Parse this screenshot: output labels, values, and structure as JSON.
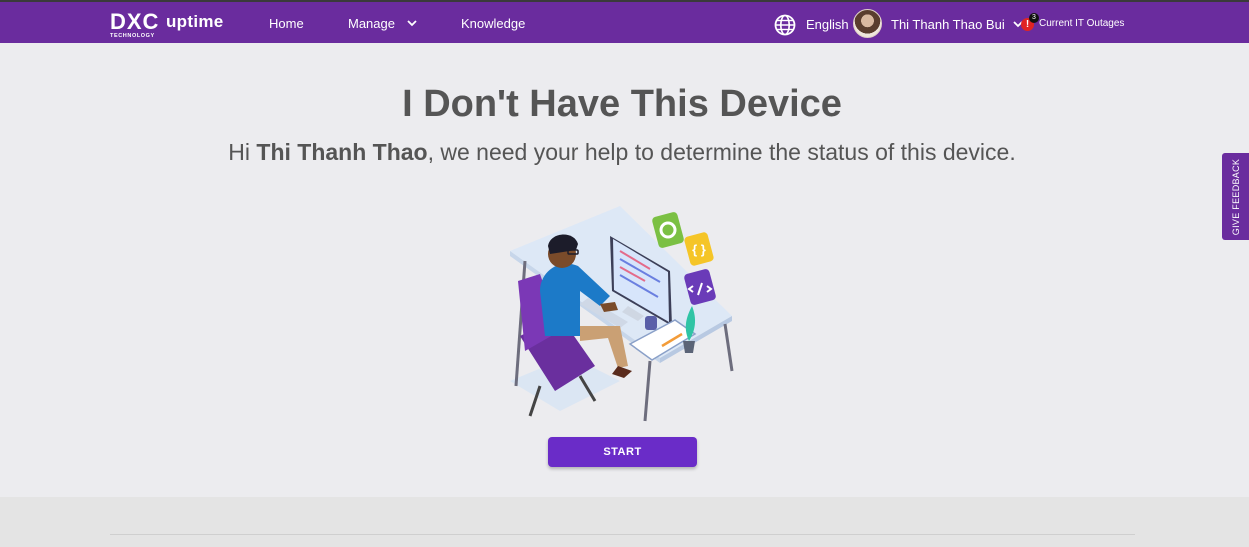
{
  "header": {
    "logo_main": "DXC",
    "logo_sub": "TECHNOLOGY",
    "app_name": "uptime",
    "nav": [
      {
        "label": "Home"
      },
      {
        "label": "Manage"
      },
      {
        "label": "Knowledge"
      }
    ],
    "language": "English",
    "user_name": "Thi Thanh Thao Bui",
    "alerts_count": "3",
    "alerts_symbol": "!",
    "outages_label": "Current IT Outages"
  },
  "main": {
    "title": "I Don't Have This Device",
    "subtitle_prefix": "Hi ",
    "subtitle_name": "Thi Thanh Thao",
    "subtitle_suffix": ", we need your help to determine the status of this device.",
    "start_label": "START"
  },
  "feedback_label": "GIVE FEEDBACK",
  "colors": {
    "brand_purple": "#6a2c9e",
    "button_purple": "#6a2cc8",
    "background": "#ececef"
  }
}
